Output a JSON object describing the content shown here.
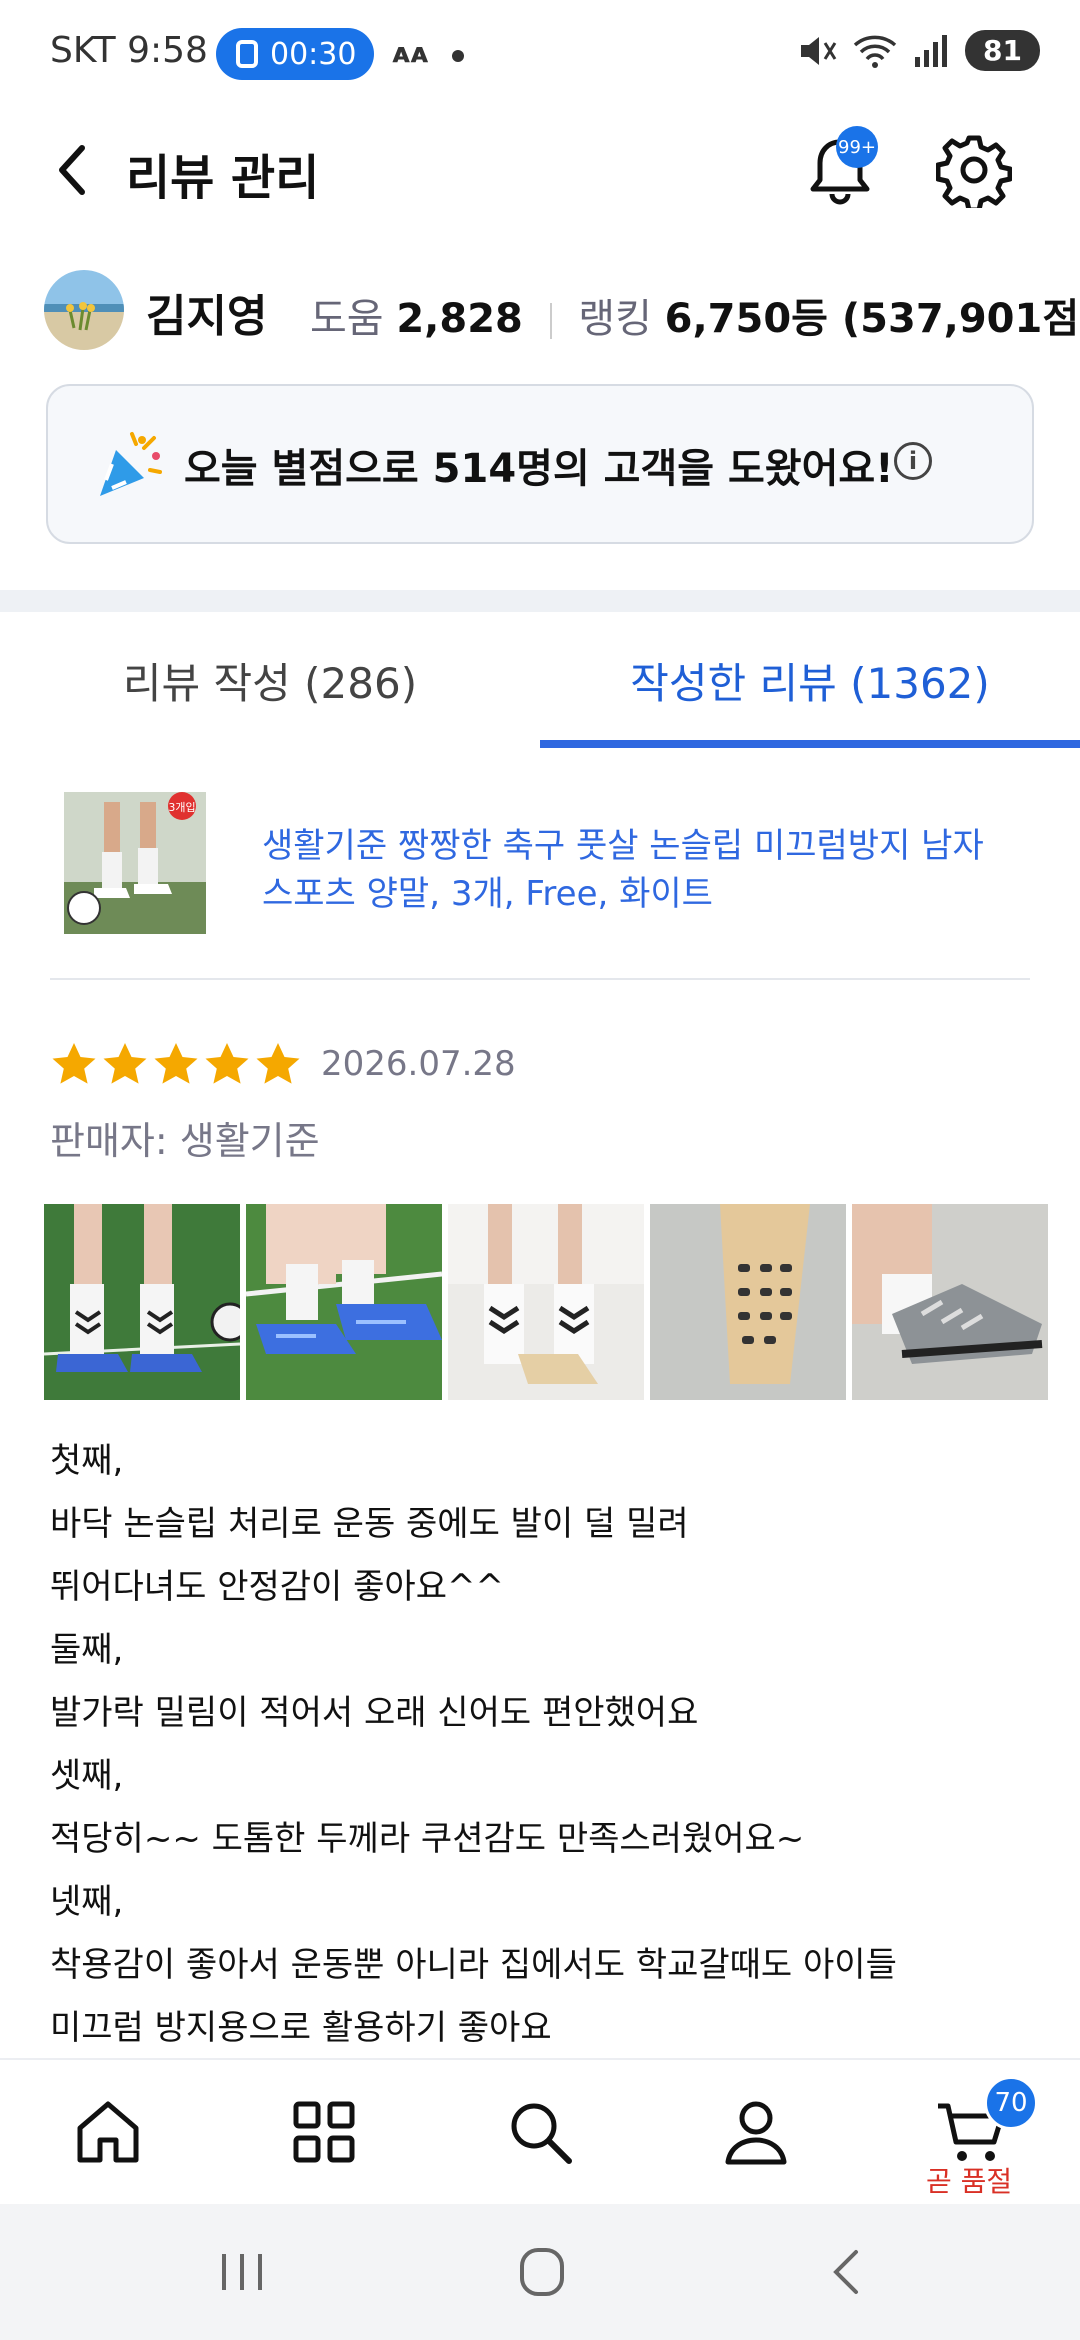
{
  "status_bar": {
    "carrier_time": "SKT 9:58",
    "call_timer": "00:30",
    "battery": "81"
  },
  "header": {
    "title": "리뷰 관리",
    "notification_badge": "99+"
  },
  "user": {
    "name": "김지영",
    "help_label": "도움",
    "help_value": "2,828",
    "rank_label": "랭킹",
    "rank_value": "6,750등 (537,901점)"
  },
  "banner": {
    "text": "오늘 별점으로 514명의 고객을 도왔어요!",
    "info_glyph": "i"
  },
  "tabs": [
    {
      "label": "리뷰 작성 (286)",
      "active": false
    },
    {
      "label": "작성한 리뷰 (1362)",
      "active": true
    }
  ],
  "product": {
    "badge": "3개입",
    "title": "생활기준 짱짱한 축구 풋살 논슬립 미끄럼방지 남자 스포츠 양말, 3개, Free, 화이트"
  },
  "review": {
    "rating": 5,
    "date": "2026.07.28",
    "seller": "판매자: 생활기준",
    "photo_count_visible": 5,
    "body_lines": [
      "첫째,",
      "바닥 논슬립 처리로 운동 중에도 발이 덜 밀려",
      "뛰어다녀도 안정감이 좋아요^^",
      "둘째,",
      "발가락 밀림이 적어서 오래 신어도 편안했어요",
      "셋째,",
      "적당히~~ 도톰한 두께라 쿠션감도 만족스러웠어요~",
      "넷째,",
      "착용감이 좋아서 운동뿐 아니라 집에서도 학교갈때도 아이들",
      "미끄럼 방지용으로 활용하기 좋아요"
    ]
  },
  "bottom_nav": {
    "items": [
      "home-icon",
      "categories-icon",
      "search-icon",
      "profile-icon",
      "cart-icon"
    ],
    "cart_badge": "70",
    "cart_label": "곧 품절"
  },
  "colors": {
    "accent": "#2f68e0",
    "badge_blue": "#1a73e8",
    "star": "#f5a800",
    "alert_red": "#d93025"
  }
}
